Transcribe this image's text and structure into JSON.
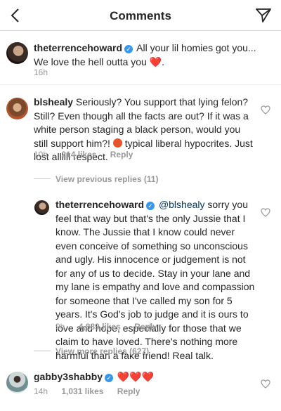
{
  "header": {
    "title": "Comments"
  },
  "caption": {
    "username": "theterrencehoward",
    "text": "All your lil homies got you... We love the hell outta you",
    "emoji": "❤️",
    "trailing": ".",
    "time": "16h"
  },
  "comment1": {
    "username": "blshealy",
    "text_a": "Seriously? You support that lying felon? Still? Even though all the facts are out? If it was a white person staging a black person, would you still support him?!",
    "text_b": "typical liberal hypocrites. Just lost allllll respect.",
    "time": "10h",
    "likes": "214 likes",
    "reply_label": "Reply",
    "view_previous": "View previous replies (11)"
  },
  "reply1": {
    "username": "theterrencehoward",
    "mention": "@blshealy",
    "text": "sorry you feel that way but that's the only Jussie that I know. The Jussie that I know could never even conceive of something so unconscious and ugly.  His innocence or judgement is not for any of us to decide.  Stay in your lane and my lane is empathy and love and compassion for someone that I've called my son for 5 years. It's God's job to judge and it is ours to love and hope, especially for those that we claim to have loved. There's nothing more harmful than a fake friend! Real talk.",
    "time": "9h",
    "likes": "4,889 likes",
    "reply_label": "Reply",
    "view_more": "View more replies (627)"
  },
  "comment2": {
    "username": "gabby3shabby",
    "emoji": "❤️❤️❤️",
    "time": "14h",
    "likes": "1,031 likes",
    "reply_label": "Reply"
  },
  "icons": {
    "back": "chevron-left-icon",
    "share": "direct-send-icon",
    "like": "heart-outline-icon",
    "verified": "verified-badge-icon"
  },
  "colors": {
    "verified": "#3897f0",
    "mention": "#003569",
    "secondary": "#999999",
    "heart": "#e0245e"
  }
}
